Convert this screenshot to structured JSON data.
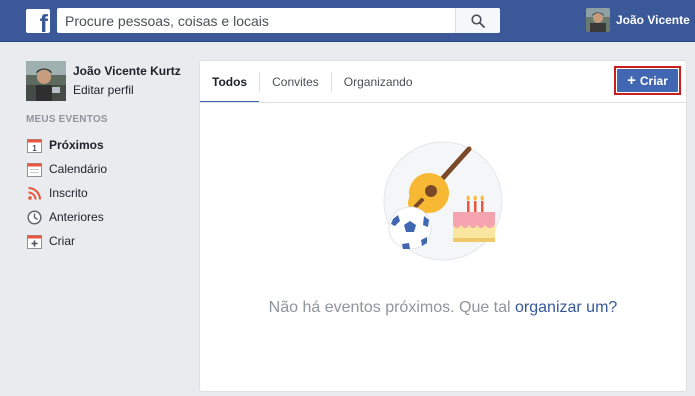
{
  "topbar": {
    "logo": "f",
    "search_placeholder": "Procure pessoas, coisas e locais",
    "user_name": "João Vicente"
  },
  "sidebar": {
    "profile_name": "João Vicente Kurtz",
    "edit_profile": "Editar perfil",
    "section_title": "MEUS EVENTOS",
    "calendar_day": "1",
    "items": [
      {
        "label": "Próximos",
        "icon": "calendar-day-icon"
      },
      {
        "label": "Calendário",
        "icon": "calendar-icon"
      },
      {
        "label": "Inscrito",
        "icon": "rss-icon"
      },
      {
        "label": "Anteriores",
        "icon": "clock-icon"
      },
      {
        "label": "Criar",
        "icon": "calendar-plus-icon"
      }
    ]
  },
  "main": {
    "tabs": [
      {
        "label": "Todos"
      },
      {
        "label": "Convites"
      },
      {
        "label": "Organizando"
      }
    ],
    "create_label": "Criar",
    "empty_text": "Não há eventos próximos. Que tal ",
    "empty_link": "organizar um?"
  },
  "colors": {
    "topbar": "#3b5998",
    "accent": "#4267b2",
    "highlight_border": "#c81e1e",
    "link": "#365899",
    "muted": "#90949c"
  }
}
